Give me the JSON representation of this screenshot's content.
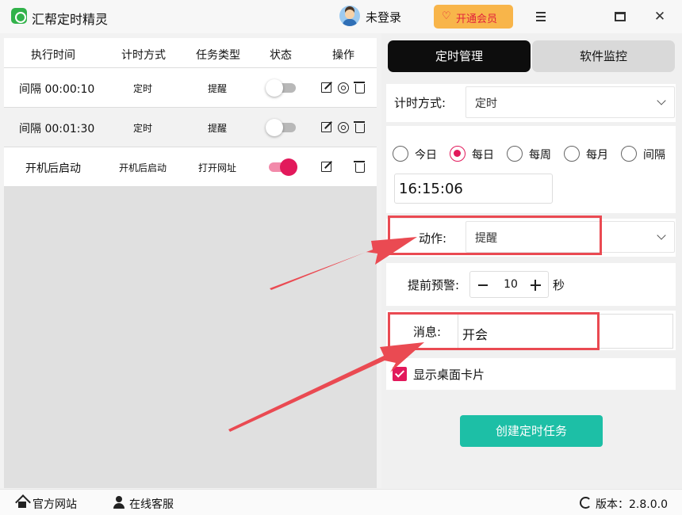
{
  "app": {
    "title": "汇帮定时精灵",
    "accent": "#e2195b",
    "primary_button_color": "#1dbfa6"
  },
  "header": {
    "user_status": "未登录",
    "vip_label": "开通会员"
  },
  "table": {
    "headers": [
      "执行时间",
      "计时方式",
      "任务类型",
      "状态",
      "操作"
    ],
    "rows": [
      {
        "time": "间隔 00:00:10",
        "mode": "定时",
        "type": "提醒",
        "enabled": false
      },
      {
        "time": "间隔 00:01:30",
        "mode": "定时",
        "type": "提醒",
        "enabled": false
      },
      {
        "time": "开机后启动",
        "mode": "开机后启动",
        "type": "打开网址",
        "enabled": true
      }
    ]
  },
  "tabs": [
    {
      "label": "定时管理",
      "active": true
    },
    {
      "label": "软件监控",
      "active": false
    }
  ],
  "form": {
    "timing_label": "计时方式:",
    "timing_value": "定时",
    "frequency_options": [
      "今日",
      "每日",
      "每周",
      "每月",
      "间隔"
    ],
    "frequency_selected": "每日",
    "time_value": "16:15:06",
    "action_label": "动作:",
    "action_value": "提醒",
    "advance_label": "提前预警:",
    "advance_value": "10",
    "advance_unit": "秒",
    "message_label": "消息:",
    "message_value": "开会",
    "show_card_label": "显示桌面卡片",
    "show_card_checked": true,
    "create_button": "创建定时任务"
  },
  "status_bar": {
    "website": "官方网站",
    "support": "在线客服",
    "version": "版本：2.8.0.0"
  }
}
